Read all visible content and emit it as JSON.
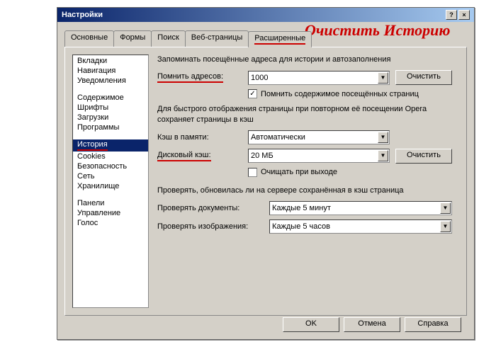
{
  "window": {
    "title": "Настройки"
  },
  "tabs": [
    "Основные",
    "Формы",
    "Поиск",
    "Веб-страницы",
    "Расширенные"
  ],
  "active_tab": 4,
  "sidebar": {
    "groups": [
      [
        "Вкладки",
        "Навигация",
        "Уведомления"
      ],
      [
        "Содержимое",
        "Шрифты",
        "Загрузки",
        "Программы"
      ],
      [
        "История",
        "Cookies",
        "Безопасность",
        "Сеть",
        "Хранилище"
      ],
      [
        "Панели",
        "Управление",
        "Голос"
      ]
    ],
    "selected": "История"
  },
  "content": {
    "remember_desc": "Запоминать посещённые адреса для истории и автозаполнения",
    "remember_label": "Помнить адресов:",
    "remember_value": "1000",
    "clear1": "Очистить",
    "remember_content_cb": {
      "checked": true,
      "label": "Помнить содержимое посещённых страниц"
    },
    "cache_desc": "Для быстрого отображения страницы при повторном её посещении Opera сохраняет страницы в кэш",
    "mem_cache_label": "Кэш в памяти:",
    "mem_cache_value": "Автоматически",
    "disk_cache_label": "Дисковый кэш:",
    "disk_cache_value": "20 МБ",
    "clear2": "Очистить",
    "clear_exit_cb": {
      "checked": false,
      "label": "Очищать при выходе"
    },
    "check_desc": "Проверять, обновилась ли на сервере сохранённая в кэш страница",
    "check_docs_label": "Проверять документы:",
    "check_docs_value": "Каждые 5 минут",
    "check_imgs_label": "Проверять изображения:",
    "check_imgs_value": "Каждые 5 часов"
  },
  "footer": {
    "ok": "OK",
    "cancel": "Отмена",
    "help": "Справка"
  },
  "annotation": {
    "text": "Очистить Историю"
  }
}
